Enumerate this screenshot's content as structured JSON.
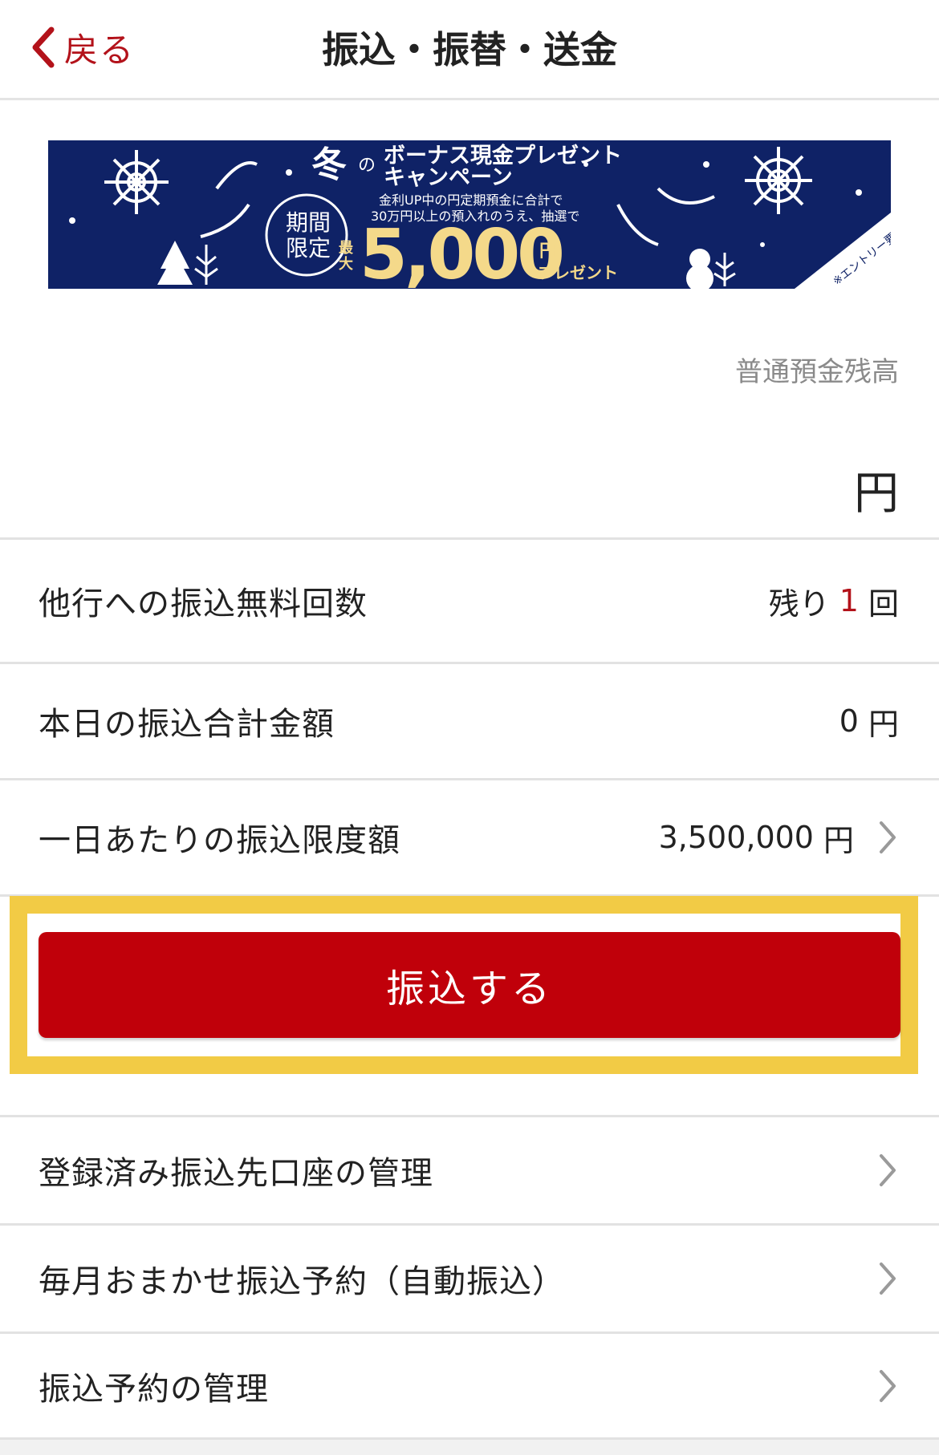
{
  "header": {
    "back_label": "戻る",
    "title": "振込・振替・送金"
  },
  "banner": {
    "headline_main": "冬",
    "headline_particle": "の",
    "headline_1": "ボーナス現金プレゼント",
    "headline_2": "キャンペーン",
    "sub_1": "金利UP中の円定期預金に合計で",
    "sub_2": "30万円以上の預入れのうえ、抽選で",
    "badge_1": "期間",
    "badge_2": "限定",
    "max_1": "最",
    "max_2": "大",
    "amount": "5,000",
    "unit": "円",
    "present": "プレゼント",
    "entry": "※エントリー要"
  },
  "balance": {
    "label": "普通預金残高",
    "value": "",
    "unit": "円"
  },
  "rows": [
    {
      "label": "他行への振込無料回数",
      "prefix": "残り",
      "value": "1",
      "unit": "回"
    },
    {
      "label": "本日の振込合計金額",
      "value": "0",
      "unit": "円"
    },
    {
      "label": "一日あたりの振込限度額",
      "value": "3,500,000",
      "unit": "円"
    }
  ],
  "transfer_button": "振込する",
  "menu": [
    {
      "label": "登録済み振込先口座の管理"
    },
    {
      "label": "毎月おまかせ振込予約（自動振込）"
    },
    {
      "label": "振込予約の管理"
    }
  ],
  "colors": {
    "accent": "#c0000a",
    "highlight": "#f2cb45",
    "banner_bg": "#0f2266",
    "gold": "#f4d98a"
  }
}
